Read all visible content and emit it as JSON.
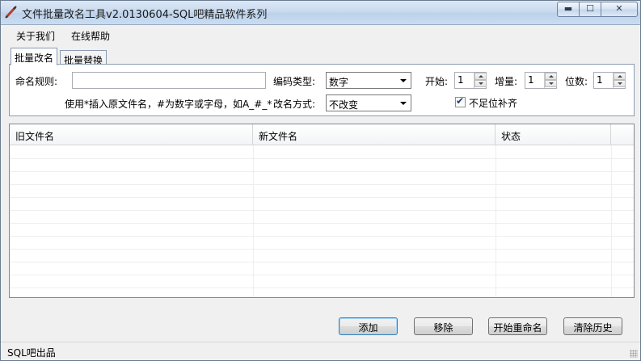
{
  "window": {
    "title": "文件批量改名工具v2.0130604-SQL吧精品软件系列",
    "minimize_glyph": "▬",
    "maximize_glyph": "☐",
    "close_glyph": "✕"
  },
  "menu": {
    "items": [
      "关于我们",
      "在线帮助"
    ]
  },
  "tabs": [
    {
      "label": "批量改名",
      "active": true
    },
    {
      "label": "批量替换",
      "active": false
    }
  ],
  "form": {
    "naming_rule_label": "命名规则:",
    "naming_rule_value": "",
    "hint": "使用*插入原文件名，#为数字或字母，如A_#_*",
    "encoding_type_label": "编码类型:",
    "encoding_type_value": "数字",
    "rename_mode_label": "改名方式:",
    "rename_mode_value": "不改变",
    "start_label": "开始:",
    "start_value": "1",
    "increment_label": "增量:",
    "increment_value": "1",
    "digits_label": "位数:",
    "digits_value": "1",
    "pad_checkbox_label": "不足位补齐",
    "pad_checkbox_checked": true
  },
  "list": {
    "columns": [
      "旧文件名",
      "新文件名",
      "状态"
    ],
    "rows": []
  },
  "buttons": {
    "add": "添加",
    "remove": "移除",
    "start_rename": "开始重命名",
    "clear_history": "清除历史"
  },
  "status": {
    "text": "SQL吧出品"
  },
  "colors": {
    "titlebar": "#c7d9ee",
    "window_bg": "#f0f0f0",
    "accent_border": "#3c7fb1"
  },
  "icons": {
    "app": "pen-icon",
    "check": "checkmark-icon"
  }
}
